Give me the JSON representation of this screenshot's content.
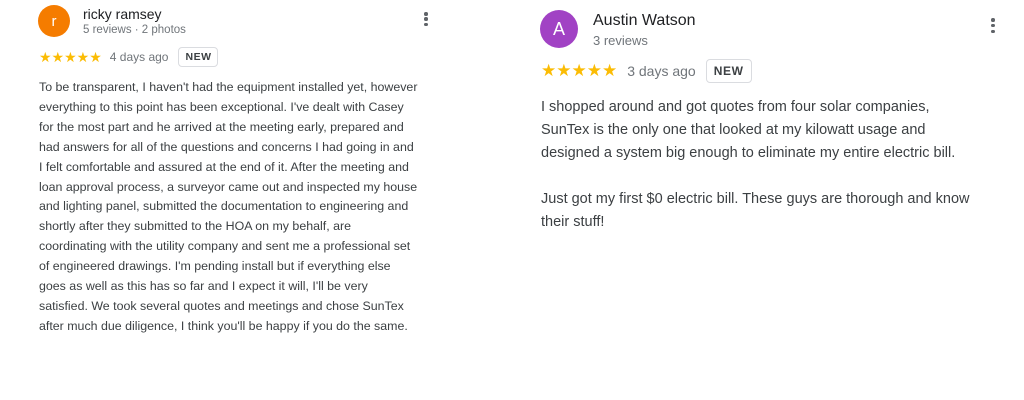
{
  "reviews": [
    {
      "author": "ricky ramsey",
      "avatar_letter": "r",
      "avatar_color": "#f57c00",
      "meta": "5 reviews · 2 photos",
      "rating": 5,
      "stars": "★★★★★",
      "date": "4 days ago",
      "badge": "NEW",
      "menu_icon": "more-vert-icon",
      "paragraphs": [
        "To be transparent, I haven't had the equipment installed yet, however everything to this point has been exceptional. I've dealt with Casey for the most part and he arrived at the meeting early, prepared and had answers for all of the questions and concerns I had going in and I felt comfortable and assured at the end of it. After the meeting and loan approval process, a surveyor came out and inspected my house and lighting panel, submitted the documentation to engineering and shortly after they submitted to the HOA on my behalf, are coordinating with the utility company and sent me a professional set of engineered drawings. I'm pending install but if everything else goes as well as this has so far and I expect it will, I'll be very satisfied. We took several quotes and meetings and chose SunTex after much due diligence, I think you'll be happy if you do the same."
      ]
    },
    {
      "author": "Austin Watson",
      "avatar_letter": "A",
      "avatar_color": "#a142c4",
      "meta": "3 reviews",
      "rating": 5,
      "stars": "★★★★★",
      "date": "3 days ago",
      "badge": "NEW",
      "menu_icon": "more-vert-icon",
      "paragraphs": [
        "I shopped around and got quotes from four solar companies, SunTex is the only one that looked at my kilowatt usage and designed a system big enough to eliminate my entire electric bill.",
        "Just got my first $0 electric bill. These guys are thorough and know their stuff!"
      ]
    }
  ]
}
